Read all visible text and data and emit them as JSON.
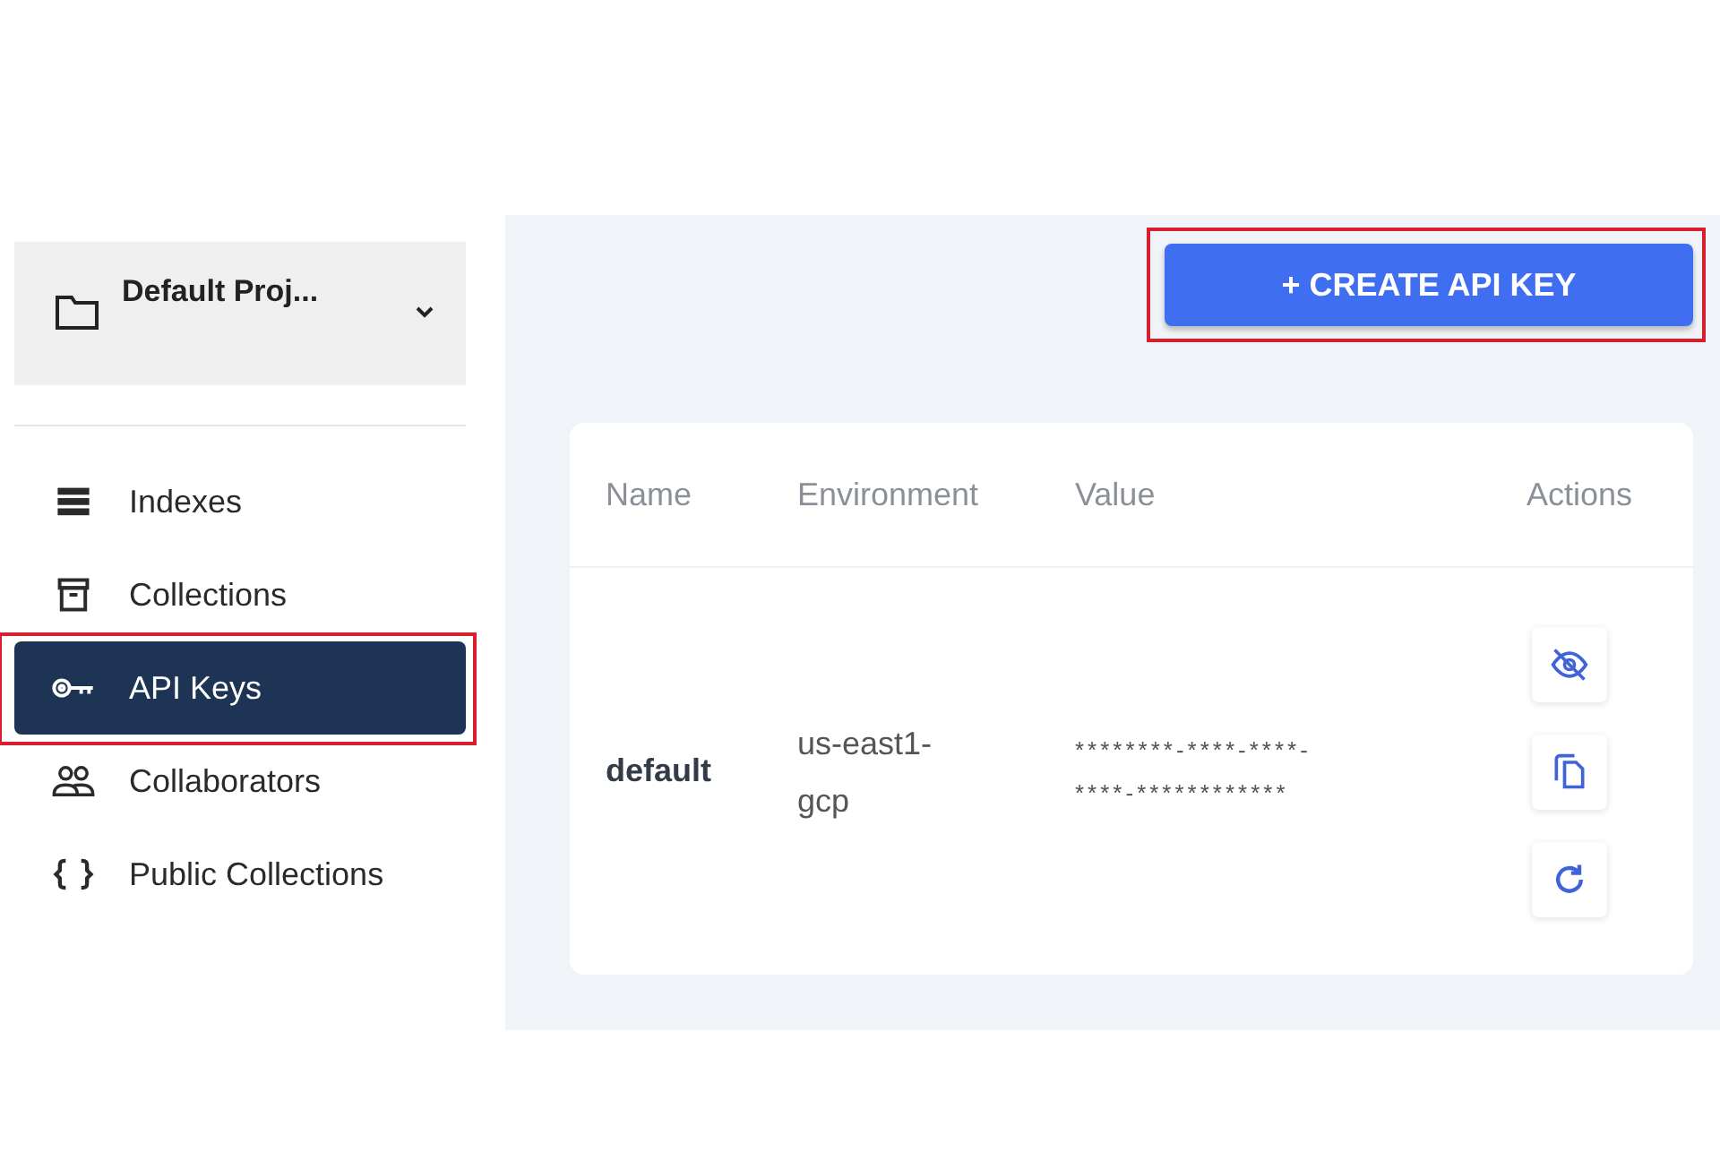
{
  "sidebar": {
    "project": {
      "name": "Default Proj..."
    },
    "items": [
      {
        "label": "Indexes",
        "kind": "list",
        "selected": false,
        "highlighted": false
      },
      {
        "label": "Collections",
        "kind": "archive",
        "selected": false,
        "highlighted": false
      },
      {
        "label": "API Keys",
        "kind": "key",
        "selected": true,
        "highlighted": true
      },
      {
        "label": "Collaborators",
        "kind": "people",
        "selected": false,
        "highlighted": false
      },
      {
        "label": "Public Collections",
        "kind": "braces",
        "selected": false,
        "highlighted": false
      }
    ]
  },
  "create_button": {
    "label": "+ CREATE API KEY",
    "highlighted": true
  },
  "table": {
    "columns": [
      "Name",
      "Environment",
      "Value",
      "Actions"
    ],
    "rows": [
      {
        "name": "default",
        "environment": "us-east1-gcp",
        "value": "********-****-****-****-************",
        "actions": [
          {
            "kind": "hide"
          },
          {
            "kind": "copy"
          },
          {
            "kind": "refresh"
          }
        ]
      }
    ]
  }
}
